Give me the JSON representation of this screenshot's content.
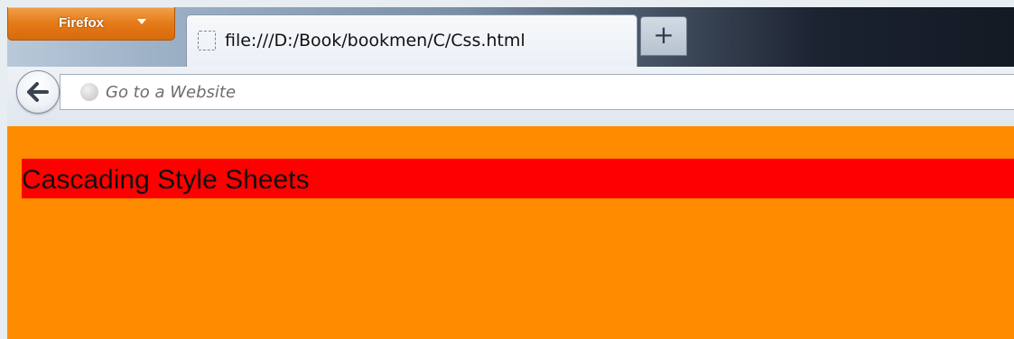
{
  "browser": {
    "app_button_label": "Firefox",
    "tab": {
      "title": "file:///D:/Book/bookmen/C/Css.html"
    },
    "new_tab_label": "+",
    "address_bar": {
      "placeholder": "Go to a Website"
    }
  },
  "page": {
    "heading": "Cascading Style Sheets",
    "background_color": "#ff8c00",
    "heading_background_color": "#ff0000"
  }
}
